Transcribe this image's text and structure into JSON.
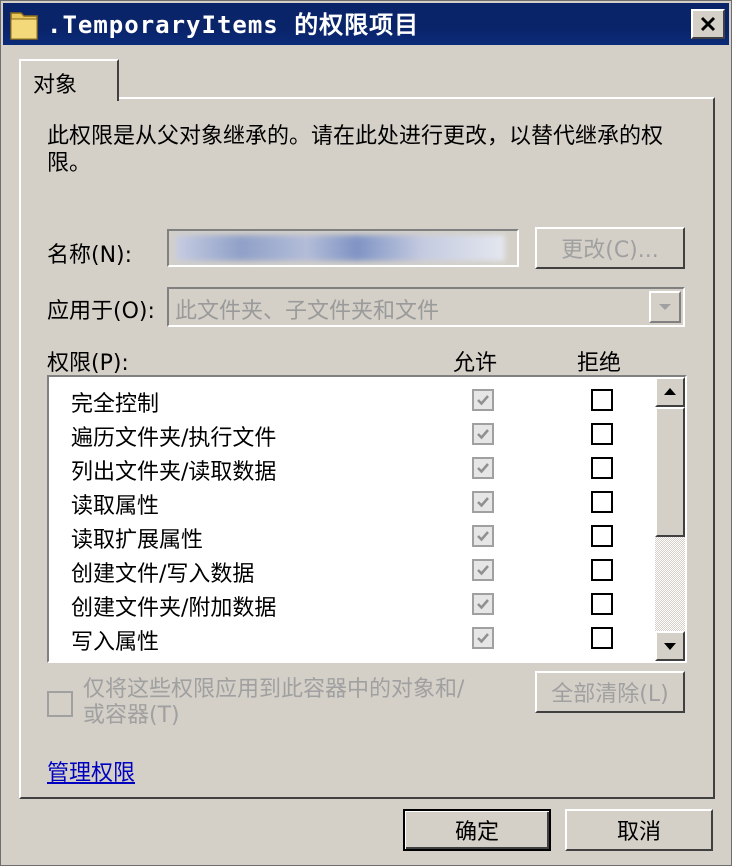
{
  "window": {
    "title": ".TemporaryItems 的权限项目",
    "icon": "folder-icon",
    "close_icon": "close-icon"
  },
  "tabs": [
    {
      "label": "对象"
    }
  ],
  "description": "此权限是从父对象继承的。请在此处进行更改，以替代继承的权限。",
  "name": {
    "label": "名称(N):",
    "value": "",
    "change_button": "更改(C)..."
  },
  "apply_to": {
    "label": "应用于(O):",
    "value": "此文件夹、子文件夹和文件"
  },
  "permissions": {
    "label": "权限(P):",
    "allow_header": "允许",
    "deny_header": "拒绝",
    "rows": [
      {
        "name": "完全控制",
        "allow": true,
        "deny": false
      },
      {
        "name": "遍历文件夹/执行文件",
        "allow": true,
        "deny": false
      },
      {
        "name": "列出文件夹/读取数据",
        "allow": true,
        "deny": false
      },
      {
        "name": "读取属性",
        "allow": true,
        "deny": false
      },
      {
        "name": "读取扩展属性",
        "allow": true,
        "deny": false
      },
      {
        "name": "创建文件/写入数据",
        "allow": true,
        "deny": false
      },
      {
        "name": "创建文件夹/附加数据",
        "allow": true,
        "deny": false
      },
      {
        "name": "写入属性",
        "allow": true,
        "deny": false
      }
    ]
  },
  "apply_inherit": {
    "label": "仅将这些权限应用到此容器中的对象和/或容器(T)",
    "checked": false
  },
  "clear_all_button": "全部清除(L)",
  "manage_link": "管理权限",
  "footer": {
    "ok": "确定",
    "cancel": "取消"
  },
  "colors": {
    "titlebar": "#0a246a",
    "face": "#d4d0c8",
    "link": "#0000c0",
    "disabled": "#a0a0a0"
  }
}
